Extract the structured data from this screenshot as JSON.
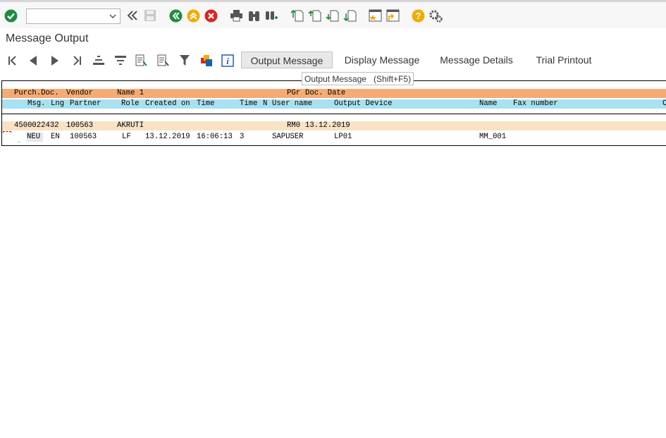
{
  "command_field": {
    "value": "",
    "placeholder": ""
  },
  "page_title": "Message Output",
  "app_toolbar": {
    "buttons": [
      "Output Message",
      "Display Message",
      "Message Details",
      "Trial Printout"
    ]
  },
  "tooltip": "Output Message   (Shift+F5)",
  "list": {
    "header1": {
      "purch_doc": "Purch.Doc.",
      "vendor": "Vendor",
      "name1": "Name 1",
      "pgr": "PGr",
      "doc_date": "Doc. Date"
    },
    "header2": {
      "msg": "Msg.",
      "lng": "Lng",
      "partner": "Partner",
      "role": "Role",
      "created_on": "Created on",
      "time": "Time",
      "time_n": "Time",
      "n": "N",
      "user_name": "User name",
      "output_device": "Output Device",
      "name": "Name",
      "fax_number": "Fax number",
      "trail": "C"
    },
    "doc_row": {
      "purch_doc": "4500022432",
      "vendor": "100563",
      "name1": "AKRUTI",
      "pgr": "RM0",
      "doc_date": "13.12.2019"
    },
    "msg_row": {
      "msg": "NEU",
      "lng": "EN",
      "partner": "100563",
      "role": "LF",
      "created_on": "13.12.2019",
      "time": "16:06:13",
      "n": "3",
      "user_name": "SAPUSER",
      "output_device": "LP01",
      "name": "MM_001"
    }
  },
  "colors": {
    "header1_bg": "#f5ab74",
    "header2_bg": "#a8e1f1",
    "doc_row_bg": "#f9e2c6",
    "accent_green": "#1c8b3e",
    "accent_orange": "#f0ab00",
    "accent_red": "#d9261c"
  }
}
